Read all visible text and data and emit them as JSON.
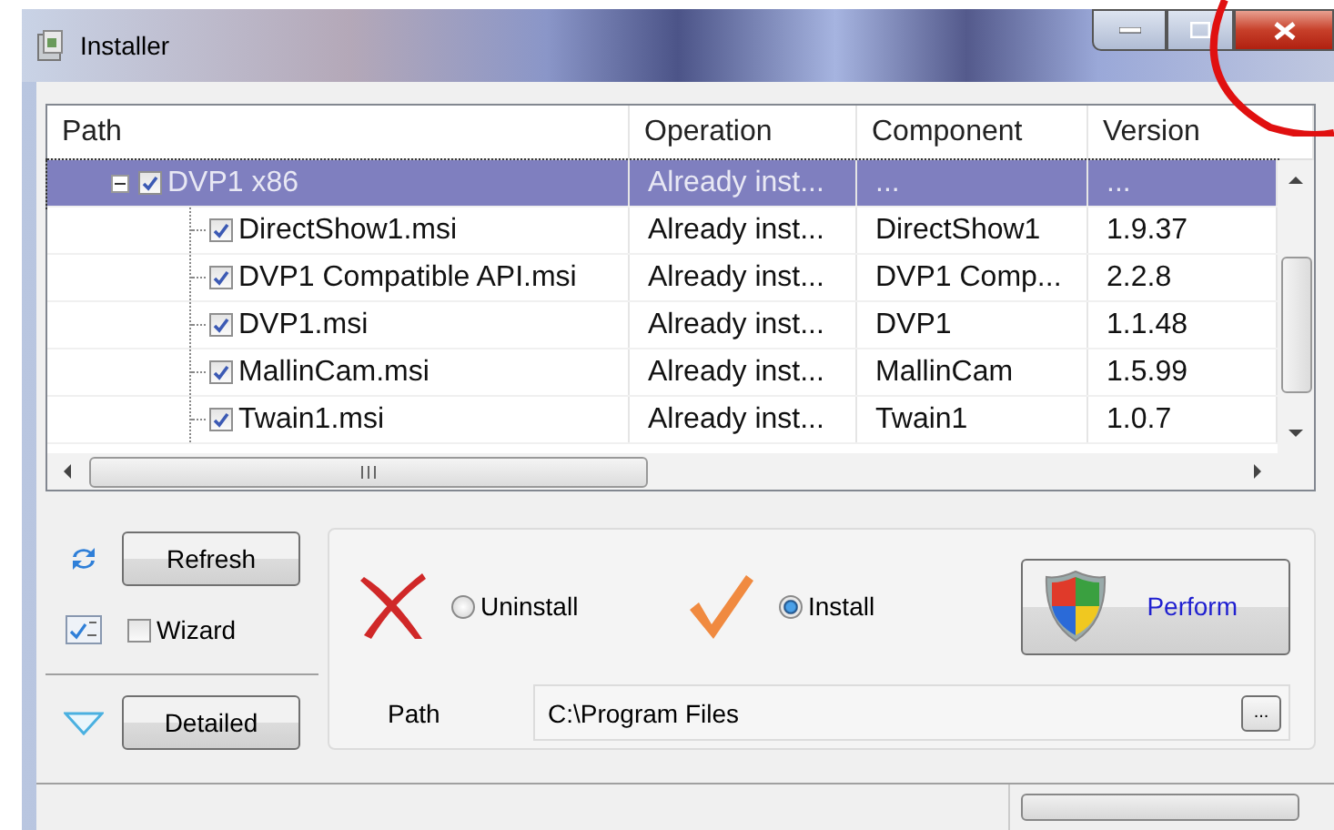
{
  "window": {
    "title": "Installer"
  },
  "tree": {
    "columns": [
      "Path",
      "Operation",
      "Component",
      "Version"
    ],
    "rows": [
      {
        "path": "DVP1 x86",
        "checked": true,
        "expanded": true,
        "selected": true,
        "operation": "Already inst...",
        "component": "...",
        "version": "...",
        "children": [
          {
            "path": "DirectShow1.msi",
            "checked": true,
            "selected": false,
            "operation": "Already inst...",
            "component": "DirectShow1",
            "version": "1.9.37"
          },
          {
            "path": "DVP1 Compatible API.msi",
            "checked": true,
            "selected": false,
            "operation": "Already inst...",
            "component": "DVP1 Comp...",
            "version": "2.2.8"
          },
          {
            "path": "DVP1.msi",
            "checked": true,
            "selected": false,
            "operation": "Already inst...",
            "component": "DVP1",
            "version": "1.1.48"
          },
          {
            "path": "MallinCam.msi",
            "checked": true,
            "selected": false,
            "operation": "Already inst...",
            "component": "MallinCam",
            "version": "1.5.99"
          },
          {
            "path": "Twain1.msi",
            "checked": true,
            "selected": false,
            "operation": "Already inst...",
            "component": "Twain1",
            "version": "1.0.7"
          }
        ]
      }
    ]
  },
  "side": {
    "refresh": "Refresh",
    "wizard": {
      "label": "Wizard",
      "checked": false
    },
    "detailed": "Detailed"
  },
  "action": {
    "options": [
      {
        "label": "Uninstall",
        "selected": false,
        "kind": "uninstall"
      },
      {
        "label": "Install",
        "selected": true,
        "kind": "install"
      }
    ],
    "perform": "Perform",
    "path_label": "Path",
    "path_value": "C:\\Program Files",
    "browse": "..."
  },
  "status_bar": {
    "progress": {
      "level": 0
    }
  }
}
